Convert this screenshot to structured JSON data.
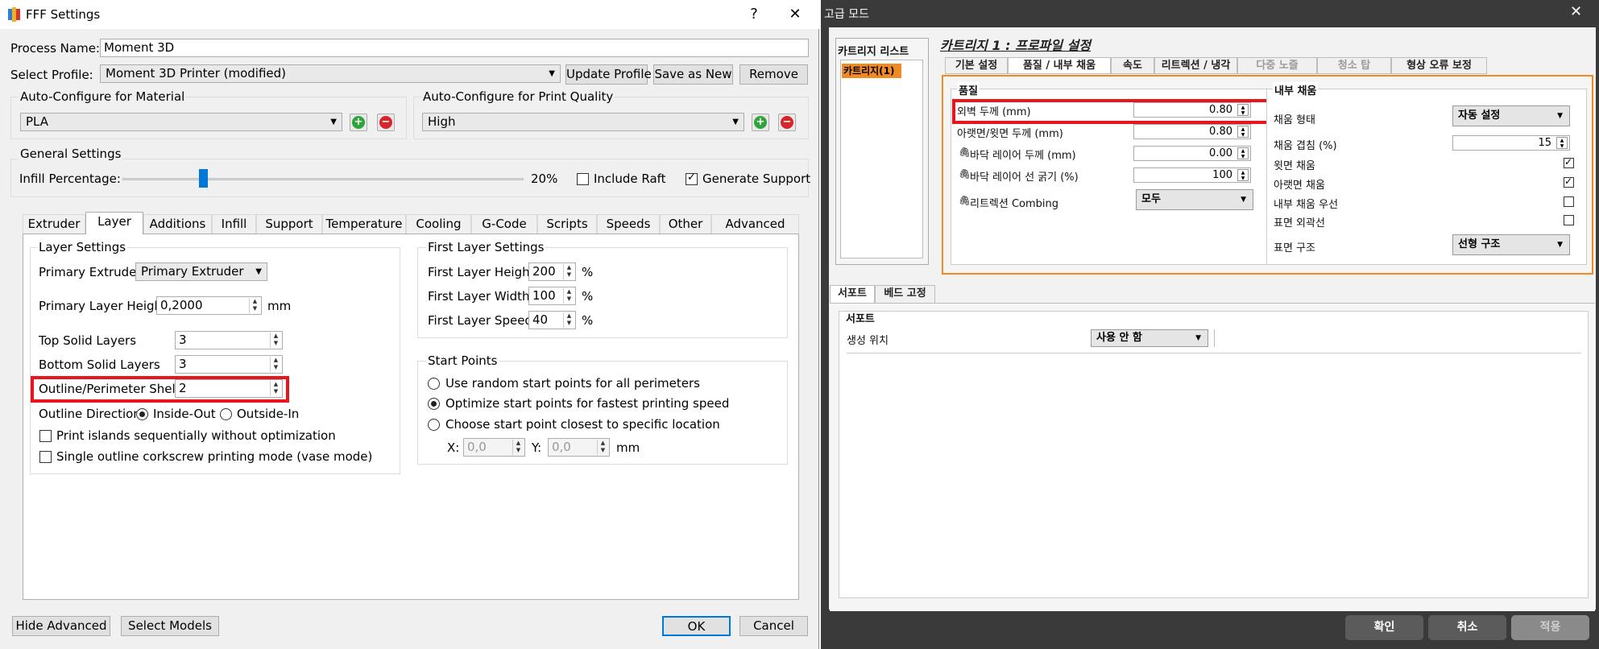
{
  "fff": {
    "title": "FFF Settings",
    "help": "?",
    "close": "✕",
    "process_name_label": "Process Name:",
    "process_name_value": "Moment 3D",
    "select_profile_label": "Select Profile:",
    "select_profile_value": "Moment 3D Printer (modified)",
    "update_profile": "Update Profile",
    "save_as_new": "Save as New",
    "remove": "Remove",
    "material_group": "Auto-Configure for Material",
    "material_value": "PLA",
    "quality_group": "Auto-Configure for Print Quality",
    "quality_value": "High",
    "general_group": "General Settings",
    "infill_label": "Infill Percentage:",
    "infill_value": "20%",
    "infill_fraction": 0.2,
    "include_raft": "Include Raft",
    "include_raft_checked": false,
    "generate_support": "Generate Support",
    "generate_support_checked": true,
    "tabs": [
      "Extruder",
      "Layer",
      "Additions",
      "Infill",
      "Support",
      "Temperature",
      "Cooling",
      "G-Code",
      "Scripts",
      "Speeds",
      "Other",
      "Advanced"
    ],
    "selected_tab": "Layer",
    "layer_settings": {
      "group": "Layer Settings",
      "primary_extruder_label": "Primary Extruder",
      "primary_extruder_value": "Primary Extruder",
      "primary_layer_height_label": "Primary Layer Height",
      "primary_layer_height_value": "0,2000",
      "unit_mm": "mm",
      "top_solid_label": "Top Solid Layers",
      "top_solid_value": "3",
      "bottom_solid_label": "Bottom Solid Layers",
      "bottom_solid_value": "3",
      "outline_shells_label": "Outline/Perimeter Shells",
      "outline_shells_value": "2",
      "outline_direction_label": "Outline Direction:",
      "inside_out": "Inside-Out",
      "outside_in": "Outside-In",
      "print_islands": "Print islands sequentially without optimization",
      "single_outline": "Single outline corkscrew printing mode (vase mode)"
    },
    "first_layer": {
      "group": "First Layer Settings",
      "height_label": "First Layer Height",
      "height_value": "200",
      "width_label": "First Layer Width",
      "width_value": "100",
      "speed_label": "First Layer Speed",
      "speed_value": "40",
      "pct": "%"
    },
    "start_points": {
      "group": "Start Points",
      "opt1": "Use random start points for all perimeters",
      "opt2": "Optimize start points for fastest printing speed",
      "opt3": "Choose start point closest to specific location",
      "x_label": "X:",
      "x_value": "0,0",
      "y_label": "Y:",
      "y_value": "0,0",
      "mm": "mm"
    },
    "hide_advanced": "Hide Advanced",
    "select_models": "Select Models",
    "ok": "OK",
    "cancel": "Cancel"
  },
  "adv": {
    "title": "고급 모드",
    "close": "✕",
    "cart_list_title": "카트리지 리스트",
    "cart_item": "카트리지(1)",
    "profile_title": "카트리지 1 : 프로파일 설정",
    "tabs": [
      "기본 설정",
      "품질 / 내부 채움",
      "속도",
      "리트렉션 / 냉각",
      "다중 노즐",
      "청소 탑",
      "형상 오류 보정"
    ],
    "selected_tab": "품질 / 내부 채움",
    "quality_group": "품질",
    "q_rows": [
      {
        "label": "외벽 두께 (mm)",
        "value": "0.80"
      },
      {
        "label": "아랫면/윗면 두께 (mm)",
        "value": "0.80"
      },
      {
        "label": "바닥 레이어 두께 (mm)",
        "value": "0.00"
      },
      {
        "label": "바닥 레이어 선 굵기 (%)",
        "value": "100"
      }
    ],
    "retraction_combing_label": "리트렉션 Combing",
    "retraction_combing_value": "모두",
    "infill_group": "내부 채움",
    "infill_type_label": "채움 형태",
    "infill_type_value": "자동 설정",
    "infill_overlap_label": "채움 겹침 (%)",
    "infill_overlap_value": "15",
    "top_fill": "윗면 채움",
    "bottom_fill": "아랫면 채움",
    "inner_first": "내부 채움 우선",
    "surface_outline": "표면 외곽선",
    "surface_structure_label": "표면 구조",
    "surface_structure_value": "선형 구조",
    "lower_tabs": [
      "서포트",
      "베드 고정"
    ],
    "support_group": "서포트",
    "support_pos_label": "생성 위치",
    "support_pos_value": "사용 안 함",
    "confirm": "확인",
    "cancel": "취소",
    "apply": "적용"
  },
  "colors": {
    "highlight_red": "#e8151c",
    "accent_orange": "#f08a24",
    "win_blue": "#0078d7"
  }
}
